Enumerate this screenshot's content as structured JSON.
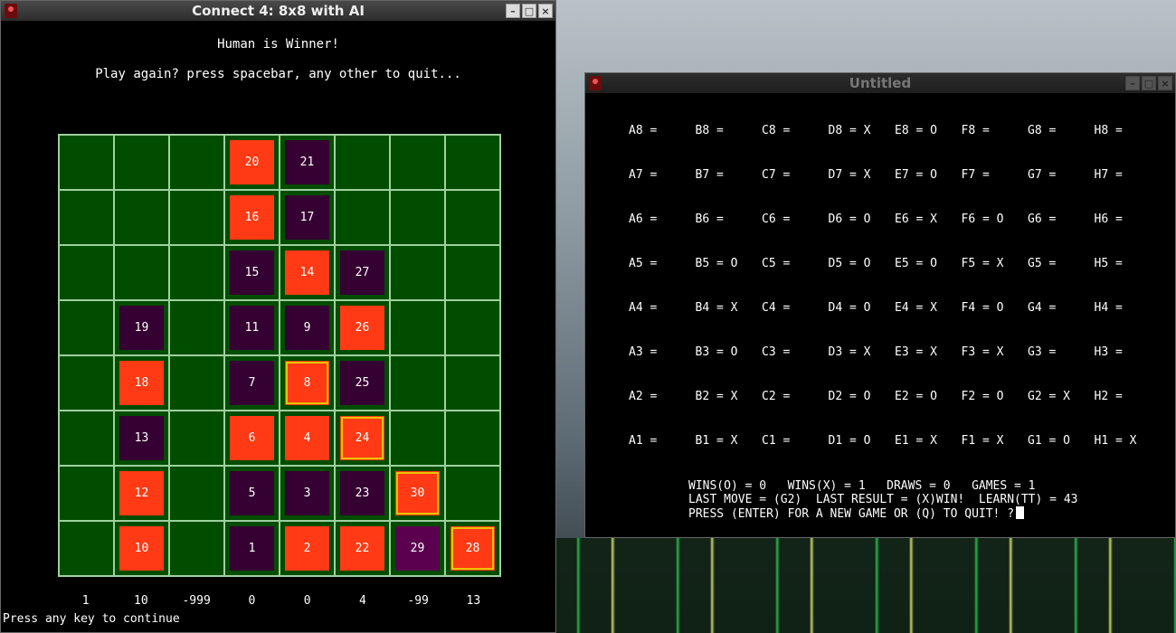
{
  "connect4_window": {
    "title": "Connect 4: 8x8 with AI",
    "winner_message": "Human is Winner!",
    "prompt": "Play again? press spacebar, any other to quit...",
    "footer": "Press any key to continue",
    "column_scores": [
      "1",
      "10",
      "-999",
      "0",
      "0",
      "4",
      "-99",
      "13"
    ],
    "rows": [
      [
        "",
        "",
        "",
        "20",
        "21",
        "",
        "",
        ""
      ],
      [
        "",
        "",
        "",
        "16",
        "17",
        "",
        "",
        ""
      ],
      [
        "",
        "",
        "",
        "15",
        "14",
        "27",
        "",
        ""
      ],
      [
        "",
        "19",
        "",
        "11",
        "9",
        "26",
        "",
        ""
      ],
      [
        "",
        "18",
        "",
        "7",
        "8",
        "25",
        "",
        ""
      ],
      [
        "",
        "13",
        "",
        "6",
        "4",
        "24",
        "",
        ""
      ],
      [
        "",
        "12",
        "",
        "5",
        "3",
        "23",
        "30",
        ""
      ],
      [
        "",
        "10",
        "",
        "1",
        "2",
        "22",
        "29",
        "28"
      ]
    ],
    "colors": {
      "red": "#ff3a14",
      "purple": "#350032",
      "board_green": "#004d00",
      "highlight": "#e8c400"
    }
  },
  "board_window": {
    "title": "Untitled",
    "rows": [
      [
        "A8 =",
        "B8 =",
        "C8 =",
        "D8 = X",
        "E8 = O",
        "F8 =",
        "G8 =",
        "H8 ="
      ],
      [
        "A7 =",
        "B7 =",
        "C7 =",
        "D7 = X",
        "E7 = O",
        "F7 =",
        "G7 =",
        "H7 ="
      ],
      [
        "A6 =",
        "B6 =",
        "C6 =",
        "D6 = O",
        "E6 = X",
        "F6 = O",
        "G6 =",
        "H6 ="
      ],
      [
        "A5 =",
        "B5 = O",
        "C5 =",
        "D5 = O",
        "E5 = O",
        "F5 = X",
        "G5 =",
        "H5 ="
      ],
      [
        "A4 =",
        "B4 = X",
        "C4 =",
        "D4 = O",
        "E4 = X",
        "F4 = O",
        "G4 =",
        "H4 ="
      ],
      [
        "A3 =",
        "B3 = O",
        "C3 =",
        "D3 = X",
        "E3 = X",
        "F3 = X",
        "G3 =",
        "H3 ="
      ],
      [
        "A2 =",
        "B2 = X",
        "C2 =",
        "D2 = O",
        "E2 = O",
        "F2 = O",
        "G2 = X",
        "H2 ="
      ],
      [
        "A1 =",
        "B1 = X",
        "C1 =",
        "D1 = O",
        "E1 = X",
        "F1 = X",
        "G1 = O",
        "H1 = X"
      ]
    ],
    "stats_line": "WINS(O) = 0   WINS(X) = 1   DRAWS = 0   GAMES = 1",
    "last_line": "LAST MOVE = (G2)  LAST RESULT = (X)WIN!  LEARN(TT) = 43",
    "prompt_line": "PRESS (ENTER) FOR A NEW GAME OR (Q) TO QUIT! ?"
  }
}
